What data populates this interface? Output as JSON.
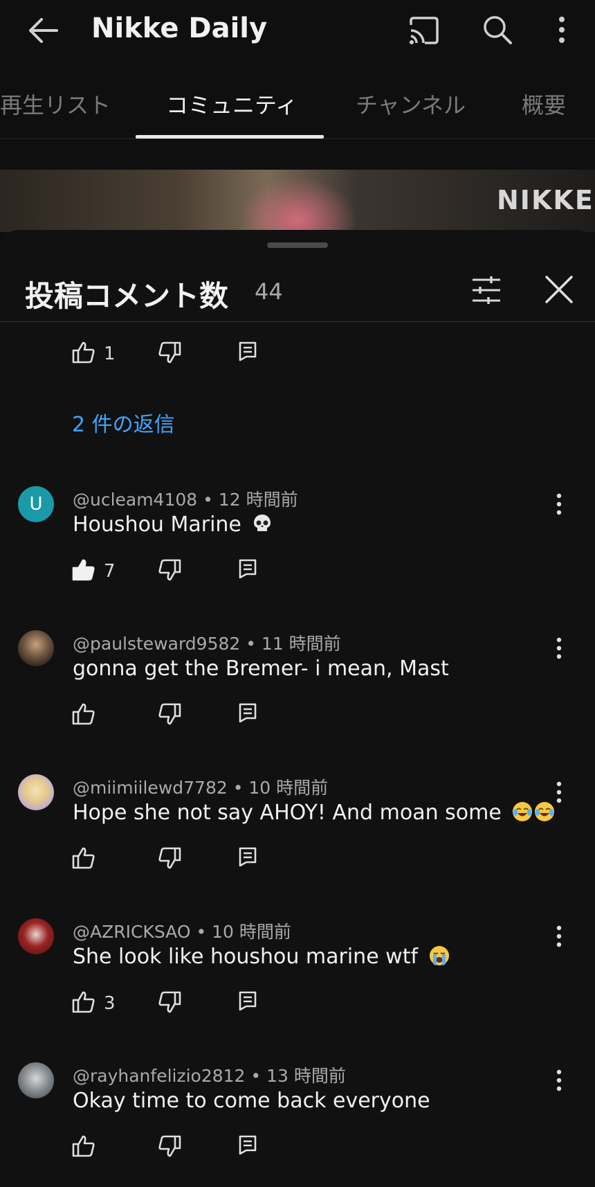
{
  "appbar": {
    "title": "Nikke Daily"
  },
  "tabs": [
    {
      "label": "再生リスト"
    },
    {
      "label": "コミュニティ"
    },
    {
      "label": "チャンネル"
    },
    {
      "label": "概要"
    }
  ],
  "banner": {
    "logo_text": "NIKKE"
  },
  "sheet": {
    "title": "投稿コメント数",
    "count": "44"
  },
  "top_actions": {
    "like_count": "1"
  },
  "replies_link": "2 件の返信",
  "comments": [
    {
      "handle": "@ucleam4108",
      "time": "12 時間前",
      "meta": "@ucleam4108 • 12 時間前",
      "text": "Houshou Marine",
      "emoji": "skull",
      "like_count": "7",
      "liked": true,
      "avatar_letter": "U",
      "avatar_color": "#1a9aa8"
    },
    {
      "handle": "@paulsteward9582",
      "time": "11 時間前",
      "meta": "@paulsteward9582 • 11 時間前",
      "text": "gonna get the Bremer- i mean, Mast",
      "like_count": ""
    },
    {
      "handle": "@miimiilewd7782",
      "time": "10 時間前",
      "meta": "@miimiilewd7782 • 10 時間前",
      "text": "Hope she not say AHOY! And moan some",
      "emoji": "tears-of-joy-x2",
      "like_count": ""
    },
    {
      "handle": "@AZRICKSAO",
      "time": "10 時間前",
      "meta": "@AZRICKSAO • 10 時間前",
      "text": "She look like houshou marine wtf",
      "emoji": "loudly-crying",
      "like_count": "3"
    },
    {
      "handle": "@rayhanfelizio2812",
      "time": "13 時間前",
      "meta": "@rayhanfelizio2812 • 13 時間前",
      "text": "Okay time to come back everyone",
      "like_count": ""
    }
  ],
  "colors": {
    "background": "#0f0f0f",
    "link": "#3ea6ff",
    "secondary_text": "#aaaaaa"
  }
}
